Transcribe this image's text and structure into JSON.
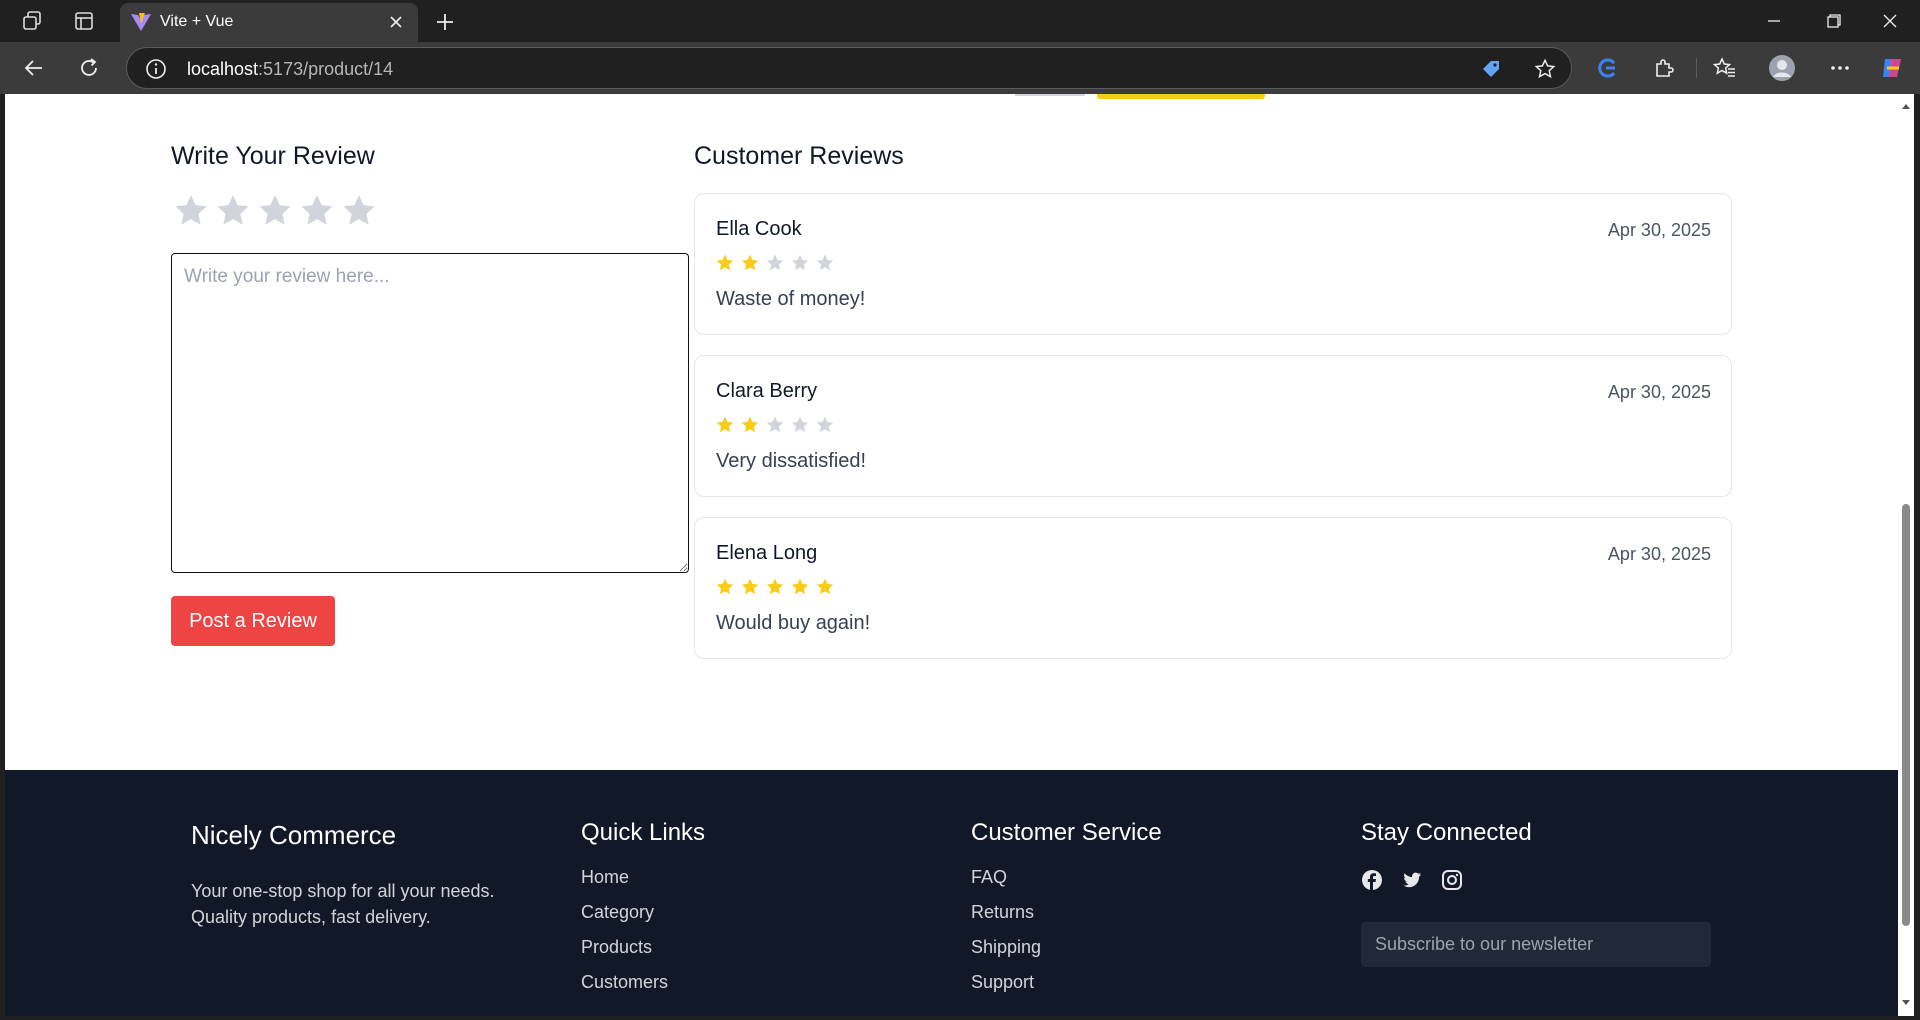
{
  "browser": {
    "tab_title": "Vite + Vue",
    "url_host": "localhost",
    "url_path": ":5173/product/14"
  },
  "review_form": {
    "title": "Write Your Review",
    "rating_selected": 0,
    "rating_max": 5,
    "placeholder": "Write your review here...",
    "submit_label": "Post a Review"
  },
  "customer_reviews": {
    "title": "Customer Reviews",
    "items": [
      {
        "name": "Ella Cook",
        "date": "Apr 30, 2025",
        "rating": 2,
        "comment": "Waste of money!"
      },
      {
        "name": "Clara Berry",
        "date": "Apr 30, 2025",
        "rating": 2,
        "comment": "Very dissatisfied!"
      },
      {
        "name": "Elena Long",
        "date": "Apr 30, 2025",
        "rating": 5,
        "comment": "Would buy again!"
      }
    ]
  },
  "footer": {
    "brand": "Nicely Commerce",
    "description": "Your one-stop shop for all your needs. Quality products, fast delivery.",
    "quick_links": {
      "heading": "Quick Links",
      "links": [
        "Home",
        "Category",
        "Products",
        "Customers"
      ]
    },
    "customer_service": {
      "heading": "Customer Service",
      "links": [
        "FAQ",
        "Returns",
        "Shipping",
        "Support"
      ]
    },
    "stay_connected": {
      "heading": "Stay Connected",
      "social_icons": [
        "facebook-icon",
        "twitter-icon",
        "instagram-icon"
      ],
      "newsletter_placeholder": "Subscribe to our newsletter"
    }
  },
  "colors": {
    "star_filled": "#facc15",
    "star_empty": "#d1d5db",
    "button": "#ef4444",
    "footer_bg": "#111827"
  }
}
